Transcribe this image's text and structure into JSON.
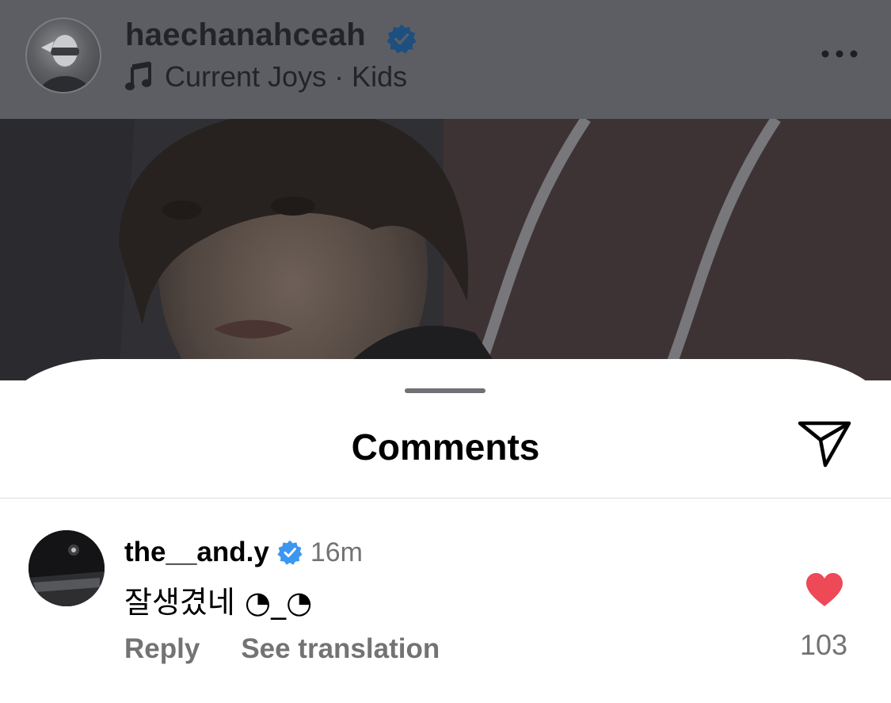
{
  "post": {
    "username": "haechanahceah",
    "music": {
      "label": "Current Joys · Kids",
      "icon": "music-note-icon"
    },
    "more_icon": "more-options-icon",
    "verified_icon": "verified-badge-icon"
  },
  "sheet": {
    "title": "Comments",
    "share_icon": "send-icon"
  },
  "comments": [
    {
      "username": "the__and.y",
      "verified": true,
      "time": "16m",
      "text": "잘생겼네 ◔_◔",
      "actions": {
        "reply": "Reply",
        "translate": "See translation"
      },
      "liked": true,
      "like_count": "103"
    }
  ],
  "colors": {
    "heart": "#ed4956",
    "verified": "#3b97f0",
    "secondary_text": "#737373"
  }
}
